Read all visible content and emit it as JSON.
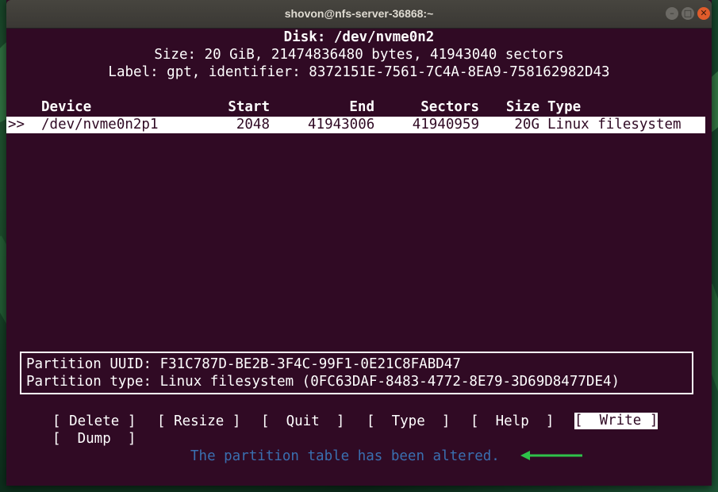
{
  "window": {
    "title": "shovon@nfs-server-36868:~",
    "controls": {
      "minimize": "–",
      "maximize": "□",
      "close": "✕"
    }
  },
  "disk": {
    "heading": "Disk: /dev/nvme0n2",
    "size_line": "Size: 20 GiB, 21474836480 bytes, 41943040 sectors",
    "label_line": "Label: gpt, identifier: 8372151E-7561-7C4A-8EA9-758162982D43"
  },
  "table": {
    "headers": {
      "device": "Device",
      "start": "Start",
      "end": "End",
      "sectors": "Sectors",
      "size": "Size",
      "type": "Type"
    },
    "rows": [
      {
        "marker": ">>",
        "device": "/dev/nvme0n2p1",
        "start": "2048",
        "end": "41943006",
        "sectors": "41940959",
        "size": "20G",
        "type": "Linux filesystem"
      }
    ]
  },
  "info": {
    "uuid_line": "Partition UUID: F31C787D-BE2B-3F4C-99F1-0E21C8FABD47",
    "type_line": "Partition type: Linux filesystem (0FC63DAF-8483-4772-8E79-3D69D8477DE4)"
  },
  "menu": {
    "delete": "[ Delete ]",
    "resize": "[ Resize ]",
    "quit": "[  Quit  ]",
    "type": "[  Type  ]",
    "help": "[  Help  ]",
    "write": "[  Write ]",
    "dump": "[  Dump  ]",
    "selected": "write"
  },
  "status": {
    "message": "The partition table has been altered.",
    "color": "#3a6fb0"
  },
  "annotation": {
    "arrow_color": "#2ec24a"
  },
  "colors": {
    "terminal_bg": "#300a24",
    "text": "#ffffff"
  }
}
